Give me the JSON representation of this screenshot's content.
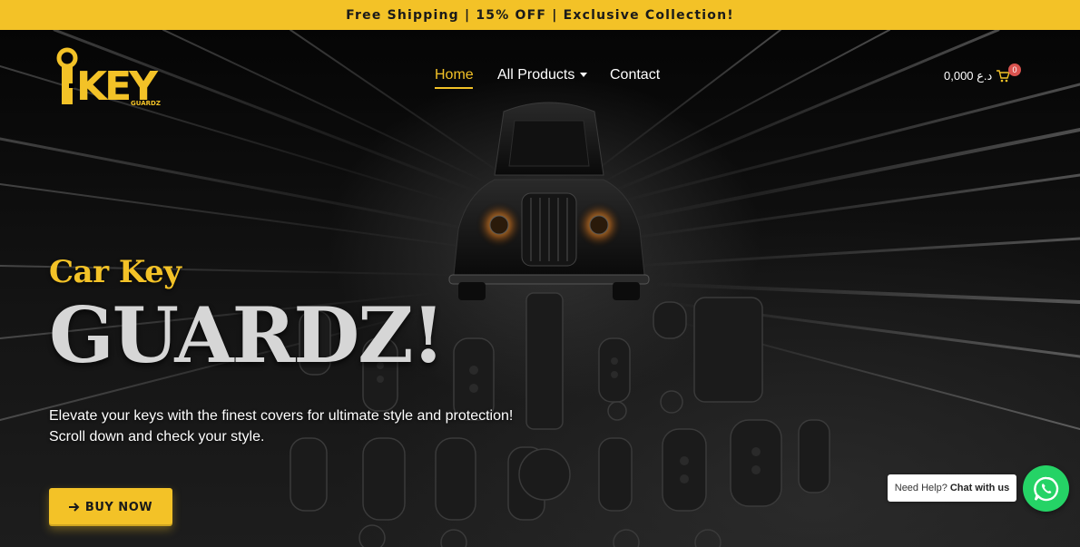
{
  "promo_bar": {
    "text": "Free Shipping | 15% OFF | Exclusive Collection!"
  },
  "header": {
    "logo_text": "KEY",
    "logo_subtext": "GUARDZ",
    "nav": {
      "home": "Home",
      "all_products": "All Products",
      "contact": "Contact"
    },
    "cart": {
      "total": "0,000 د.ع",
      "count": "0"
    }
  },
  "hero": {
    "kicker": "Car Key",
    "title": "GUARDZ!",
    "description_line1": "Elevate your keys with the finest covers for ultimate style and protection!",
    "description_line2": "Scroll down and check your style.",
    "cta_label": "BUY NOW"
  },
  "chat": {
    "prompt": "Need Help?",
    "action": "Chat with us"
  },
  "colors": {
    "brand_yellow": "#f3c227",
    "background": "#000000",
    "whatsapp_green": "#25d366",
    "badge_red": "#d9534f"
  },
  "icons": {
    "cta": "arrow-right-icon",
    "cart": "cart-icon",
    "nav_dropdown": "caret-down-icon",
    "chat": "whatsapp-icon"
  }
}
